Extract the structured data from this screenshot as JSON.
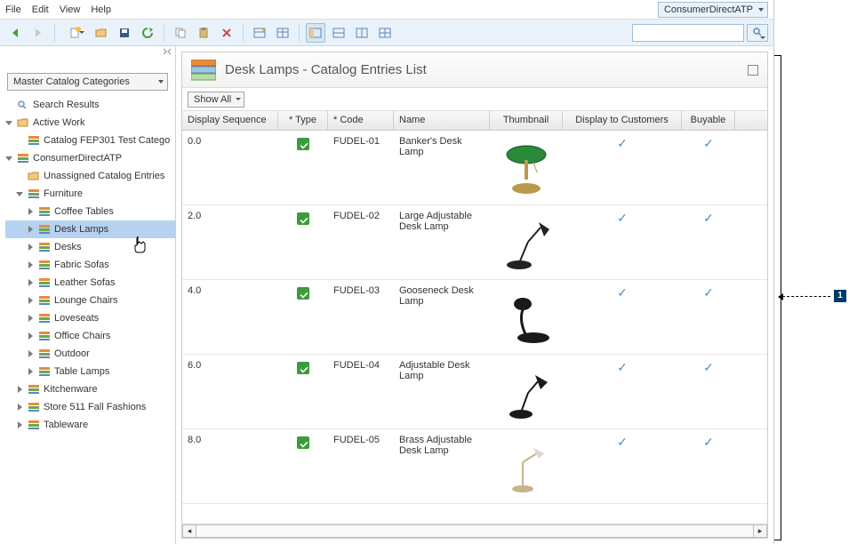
{
  "menubar": {
    "file": "File",
    "edit": "Edit",
    "view": "View",
    "help": "Help"
  },
  "store_dropdown": "ConsumerDirectATP",
  "sidebar": {
    "catalog_dropdown": "Master Catalog Categories",
    "nodes": {
      "search_results": "Search Results",
      "active_work": "Active Work",
      "fep301": "Catalog FEP301 Test Catego",
      "consumer": "ConsumerDirectATP",
      "unassigned": "Unassigned Catalog Entries",
      "furniture": "Furniture",
      "coffee_tables": "Coffee Tables",
      "desk_lamps": "Desk Lamps",
      "desks": "Desks",
      "fabric_sofas": "Fabric Sofas",
      "leather_sofas": "Leather Sofas",
      "lounge_chairs": "Lounge Chairs",
      "loveseats": "Loveseats",
      "office_chairs": "Office Chairs",
      "outdoor": "Outdoor",
      "table_lamps": "Table Lamps",
      "kitchenware": "Kitchenware",
      "store511": "Store 511 Fall Fashions",
      "tableware": "Tableware"
    }
  },
  "panel": {
    "title": "Desk Lamps - Catalog Entries List",
    "show_all": "Show All",
    "columns": {
      "seq": "Display Sequence",
      "type": "* Type",
      "code": "* Code",
      "name": "Name",
      "thumb": "Thumbnail",
      "display": "Display to Customers",
      "buyable": "Buyable"
    },
    "rows": [
      {
        "seq": "0.0",
        "code": "FUDEL-01",
        "name": "Banker's Desk Lamp"
      },
      {
        "seq": "2.0",
        "code": "FUDEL-02",
        "name": "Large Adjustable Desk Lamp"
      },
      {
        "seq": "4.0",
        "code": "FUDEL-03",
        "name": "Gooseneck Desk Lamp"
      },
      {
        "seq": "6.0",
        "code": "FUDEL-04",
        "name": "Adjustable Desk Lamp"
      },
      {
        "seq": "8.0",
        "code": "FUDEL-05",
        "name": "Brass Adjustable Desk Lamp"
      }
    ]
  },
  "callout": {
    "num": "1"
  }
}
